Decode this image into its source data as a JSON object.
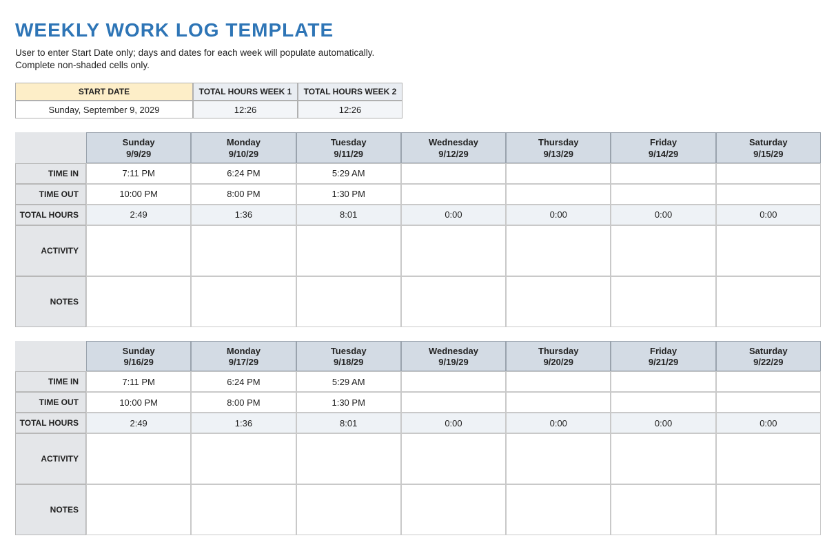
{
  "title": "WEEKLY WORK LOG TEMPLATE",
  "instructions_l1": "User to enter Start Date only; days and dates for each week will populate automatically.",
  "instructions_l2": "Complete non-shaded cells only.",
  "summary": {
    "start_date_label": "START DATE",
    "week1_label": "TOTAL HOURS WEEK 1",
    "week2_label": "TOTAL HOURS WEEK 2",
    "start_date_value": "Sunday, September 9, 2029",
    "week1_value": "12:26",
    "week2_value": "12:26"
  },
  "rowlabels": {
    "time_in": "TIME IN",
    "time_out": "TIME OUT",
    "total_hours": "TOTAL HOURS",
    "activity": "ACTIVITY",
    "notes": "NOTES"
  },
  "weeks": [
    {
      "days": [
        {
          "name": "Sunday",
          "date": "9/9/29",
          "time_in": "7:11 PM",
          "time_out": "10:00 PM",
          "total": "2:49",
          "activity": "",
          "notes": ""
        },
        {
          "name": "Monday",
          "date": "9/10/29",
          "time_in": "6:24 PM",
          "time_out": "8:00 PM",
          "total": "1:36",
          "activity": "",
          "notes": ""
        },
        {
          "name": "Tuesday",
          "date": "9/11/29",
          "time_in": "5:29 AM",
          "time_out": "1:30 PM",
          "total": "8:01",
          "activity": "",
          "notes": ""
        },
        {
          "name": "Wednesday",
          "date": "9/12/29",
          "time_in": "",
          "time_out": "",
          "total": "0:00",
          "activity": "",
          "notes": ""
        },
        {
          "name": "Thursday",
          "date": "9/13/29",
          "time_in": "",
          "time_out": "",
          "total": "0:00",
          "activity": "",
          "notes": ""
        },
        {
          "name": "Friday",
          "date": "9/14/29",
          "time_in": "",
          "time_out": "",
          "total": "0:00",
          "activity": "",
          "notes": ""
        },
        {
          "name": "Saturday",
          "date": "9/15/29",
          "time_in": "",
          "time_out": "",
          "total": "0:00",
          "activity": "",
          "notes": ""
        }
      ]
    },
    {
      "days": [
        {
          "name": "Sunday",
          "date": "9/16/29",
          "time_in": "7:11 PM",
          "time_out": "10:00 PM",
          "total": "2:49",
          "activity": "",
          "notes": ""
        },
        {
          "name": "Monday",
          "date": "9/17/29",
          "time_in": "6:24 PM",
          "time_out": "8:00 PM",
          "total": "1:36",
          "activity": "",
          "notes": ""
        },
        {
          "name": "Tuesday",
          "date": "9/18/29",
          "time_in": "5:29 AM",
          "time_out": "1:30 PM",
          "total": "8:01",
          "activity": "",
          "notes": ""
        },
        {
          "name": "Wednesday",
          "date": "9/19/29",
          "time_in": "",
          "time_out": "",
          "total": "0:00",
          "activity": "",
          "notes": ""
        },
        {
          "name": "Thursday",
          "date": "9/20/29",
          "time_in": "",
          "time_out": "",
          "total": "0:00",
          "activity": "",
          "notes": ""
        },
        {
          "name": "Friday",
          "date": "9/21/29",
          "time_in": "",
          "time_out": "",
          "total": "0:00",
          "activity": "",
          "notes": ""
        },
        {
          "name": "Saturday",
          "date": "9/22/29",
          "time_in": "",
          "time_out": "",
          "total": "0:00",
          "activity": "",
          "notes": ""
        }
      ]
    }
  ]
}
